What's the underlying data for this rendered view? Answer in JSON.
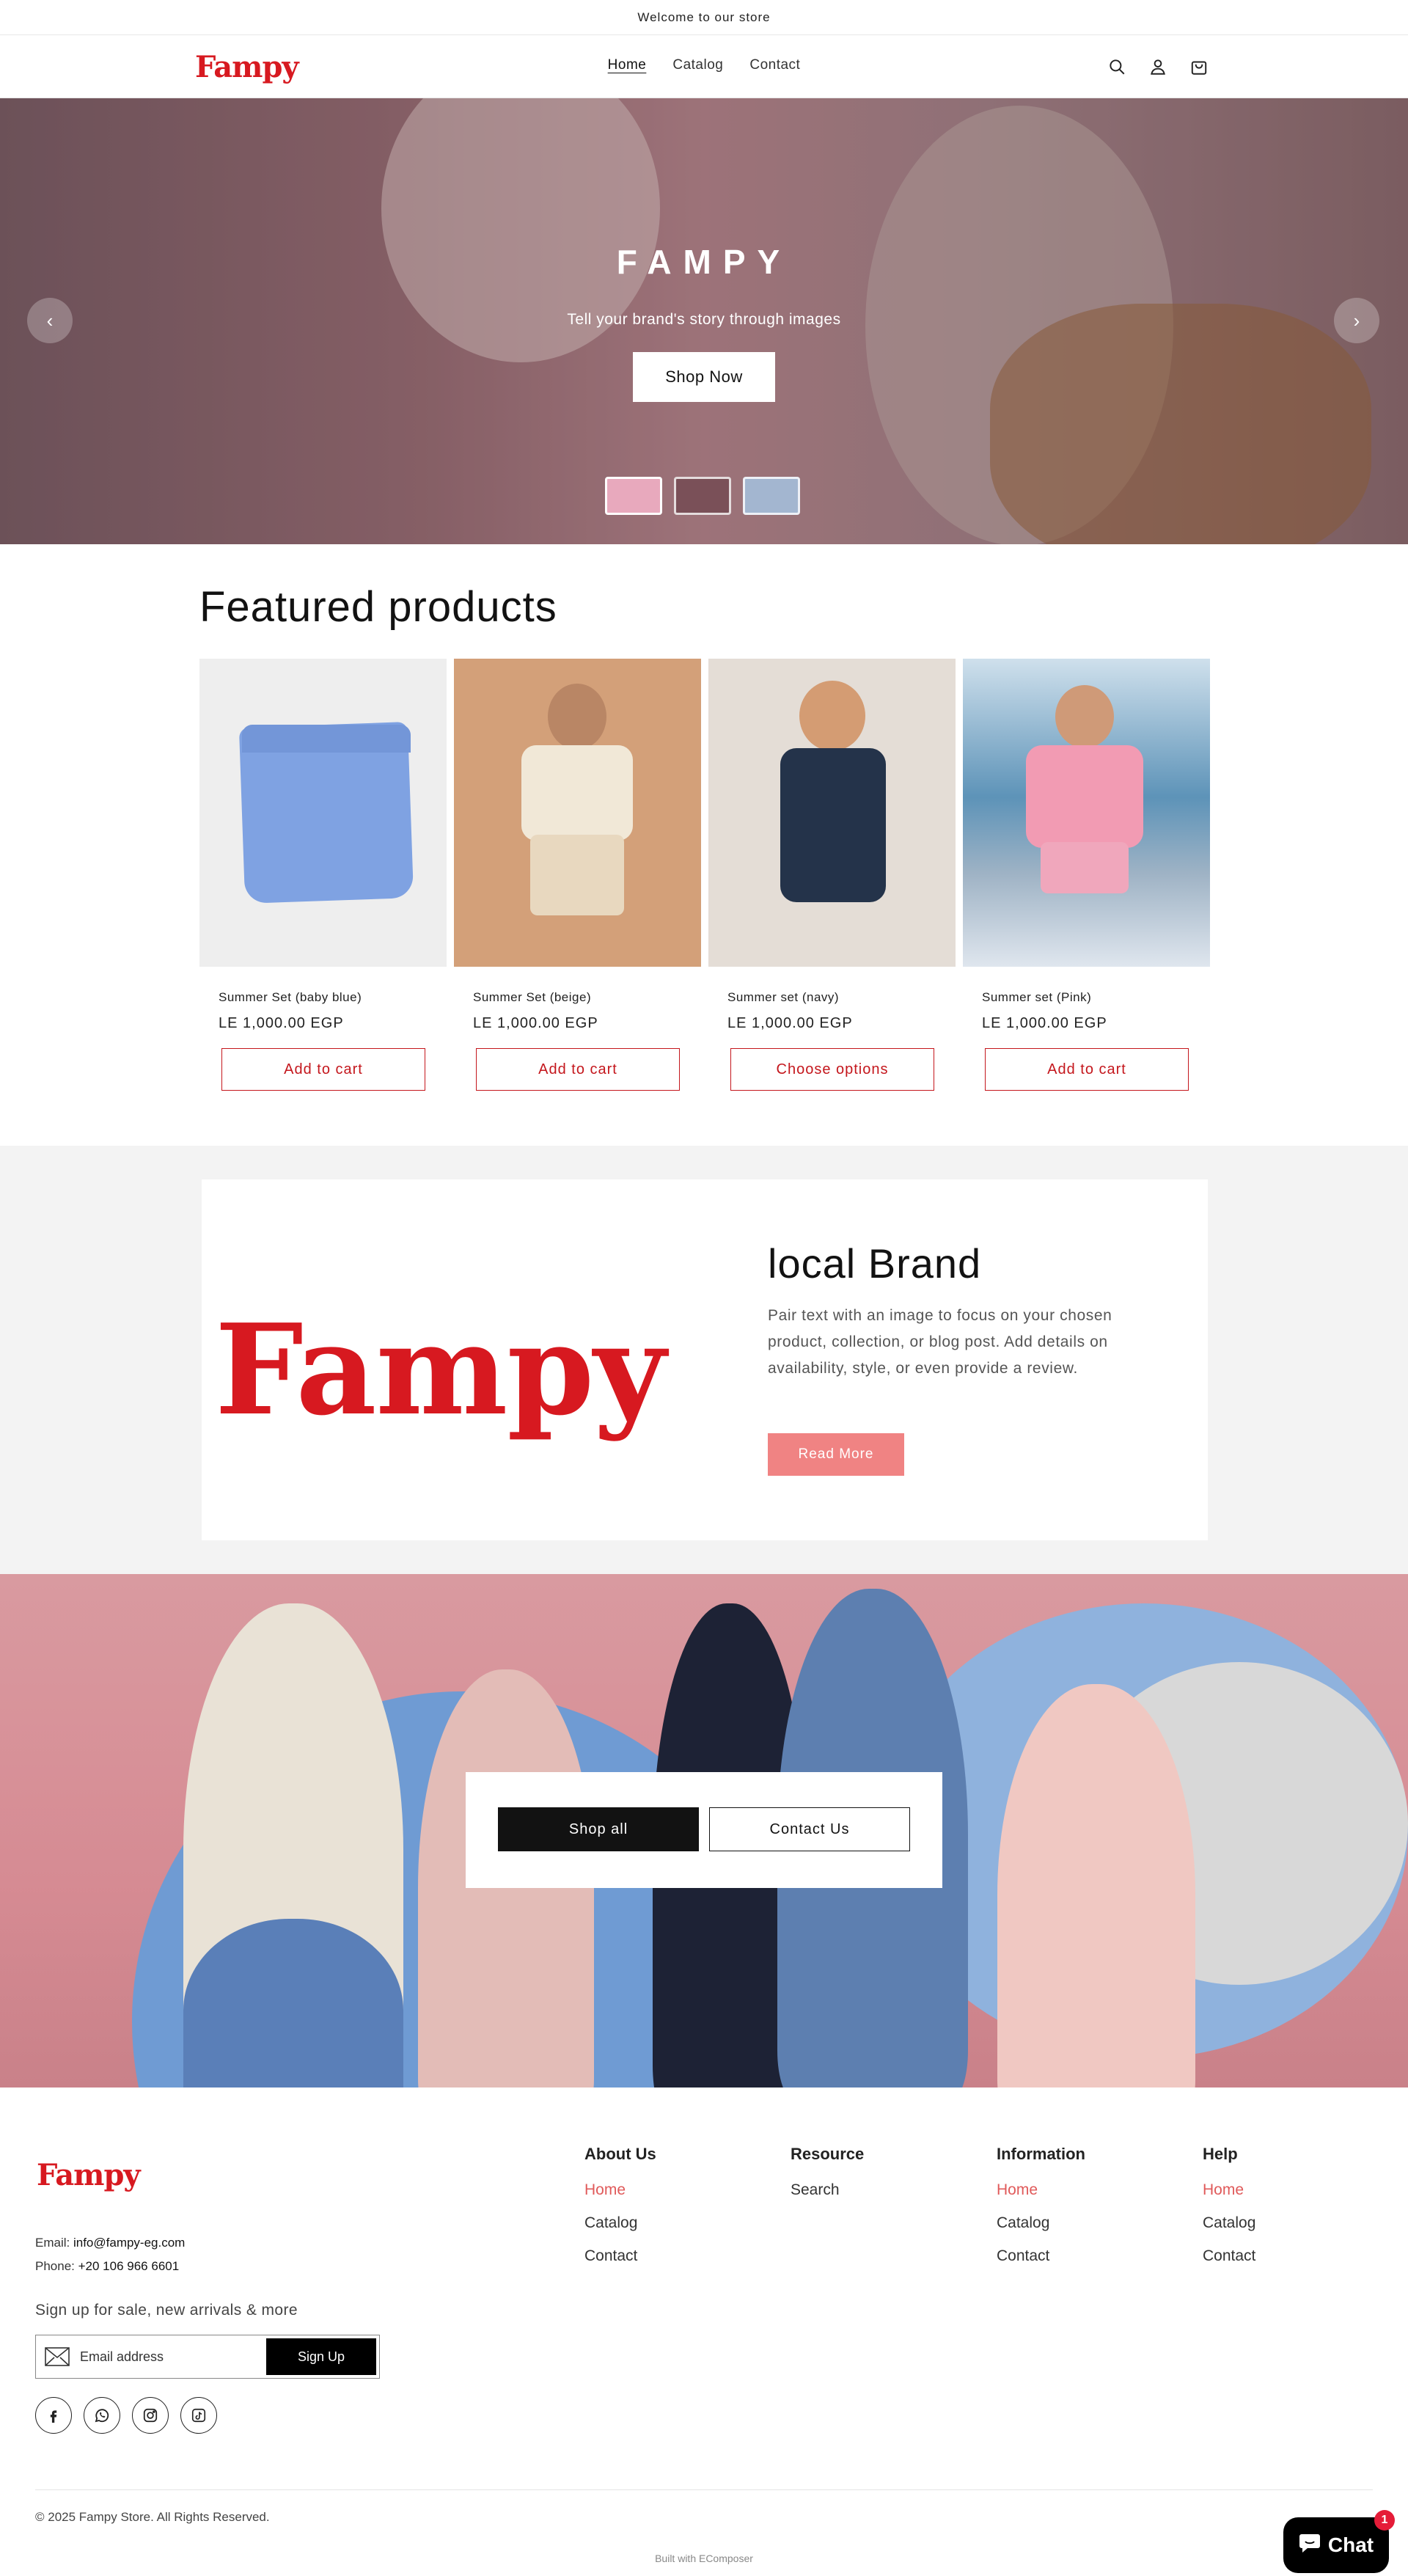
{
  "announcement": "Welcome to our store",
  "brand": {
    "logo": "Fampy"
  },
  "nav": [
    {
      "label": "Home"
    },
    {
      "label": "Catalog"
    },
    {
      "label": "Contact"
    }
  ],
  "header_icons": [
    "search-icon",
    "account-icon",
    "cart-icon"
  ],
  "hero": {
    "title": "FAMPY",
    "subtitle": "Tell your brand's story through images",
    "button": "Shop Now",
    "prev": "‹",
    "next": "›"
  },
  "featured": {
    "title": "Featured products",
    "products": [
      {
        "name": "Summer Set (baby blue)",
        "price": "LE 1,000.00 EGP",
        "button": "Add to cart"
      },
      {
        "name": "Summer Set (beige)",
        "price": "LE 1,000.00 EGP",
        "button": "Add to cart"
      },
      {
        "name": "Summer set (navy)",
        "price": "LE 1,000.00 EGP",
        "button": "Choose options"
      },
      {
        "name": "Summer set (Pink)",
        "price": "LE 1,000.00 EGP",
        "button": "Add to cart"
      }
    ]
  },
  "local_brand": {
    "logo": "Fampy",
    "title": "local Brand",
    "text": "Pair text with an image to focus on your chosen product, collection, or blog post. Add details on availability, style, or even provide a review.",
    "button": "Read More"
  },
  "banner": {
    "shop_all": "Shop all",
    "contact_us": "Contact Us"
  },
  "footer": {
    "logo": "Fampy",
    "email_label": "Email:",
    "email": "info@fampy-eg.com",
    "phone_label": "Phone:",
    "phone": "+20 106 966 6601",
    "signup_label": "Sign up for sale, new arrivals & more",
    "email_placeholder": "Email address",
    "signup_button": "Sign Up",
    "socials": [
      "facebook-icon",
      "whatsapp-icon",
      "instagram-icon",
      "tiktok-icon"
    ],
    "columns": [
      {
        "title": "About Us",
        "links": [
          "Home",
          "Catalog",
          "Contact"
        ]
      },
      {
        "title": "Resource",
        "links": [
          "Search"
        ]
      },
      {
        "title": "Information",
        "links": [
          "Home",
          "Catalog",
          "Contact"
        ]
      },
      {
        "title": "Help",
        "links": [
          "Home",
          "Catalog",
          "Contact"
        ]
      }
    ],
    "copyright": "© 2025 Fampy Store. All Rights Reserved.",
    "built_with": "Built with EComposer"
  },
  "chat": {
    "label": "Chat",
    "badge": "1"
  },
  "colors": {
    "brand_red": "#d71920",
    "accent_pink": "#f08383",
    "link_red": "#e05a5a"
  }
}
